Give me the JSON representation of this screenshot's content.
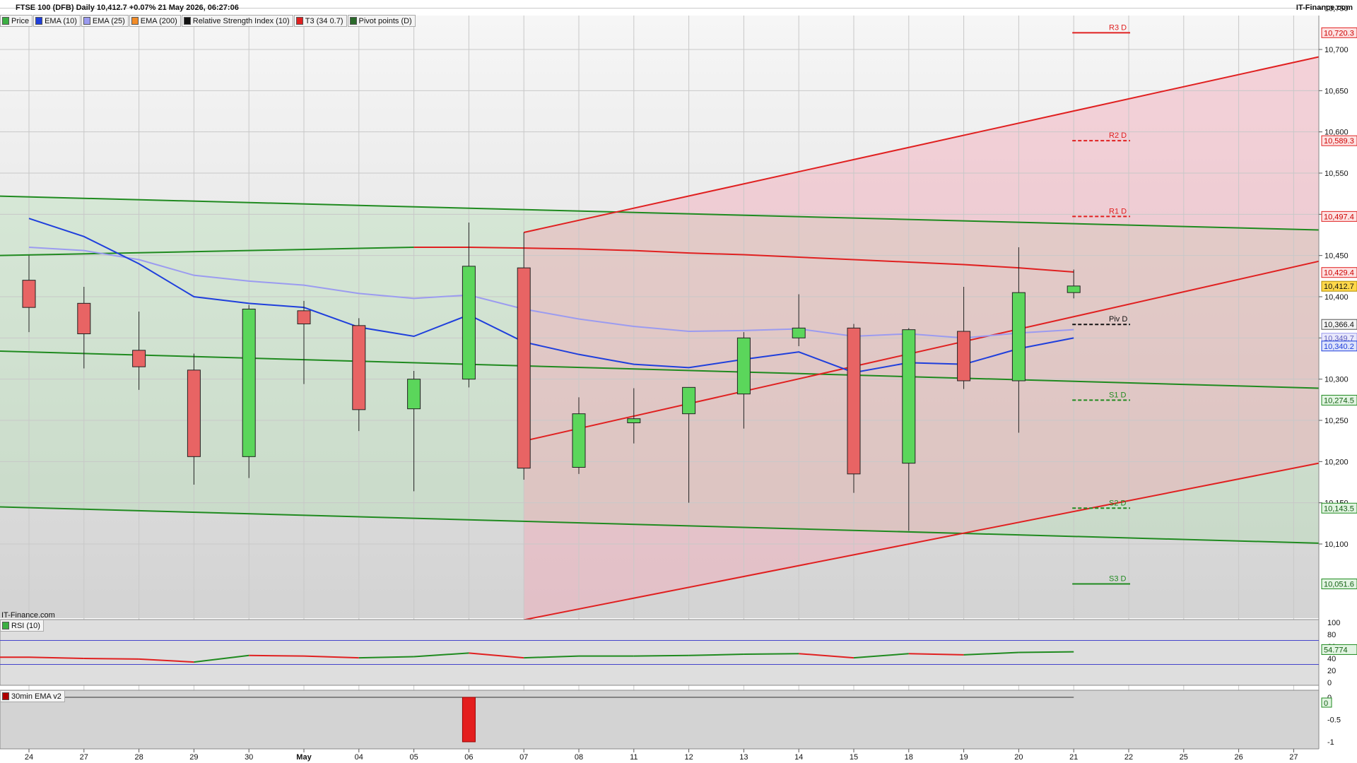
{
  "title": "FTSE 100 (DFB) Daily 10,412.7 +0.07% 21 May 2026, 06:27:06",
  "brand": "IT-Finance.com",
  "watermark": "IT-Finance.com",
  "legend": [
    {
      "label": "Price",
      "color": "#3cb043"
    },
    {
      "label": "EMA (10)",
      "color": "#1f3fdc"
    },
    {
      "label": "EMA (25)",
      "color": "#9b9bf0"
    },
    {
      "label": "EMA (200)",
      "color": "#f28c28"
    },
    {
      "label": "Relative Strength Index (10)",
      "color": "#111111"
    },
    {
      "label": "T3 (34 0.7)",
      "color": "#e02020"
    },
    {
      "label": "Pivot points (D)",
      "color": "#2a6a2a"
    }
  ],
  "rsi_panel": {
    "label": "RSI (10)",
    "ticks": [
      "100",
      "80",
      "60",
      "40",
      "20",
      "0"
    ],
    "last": "54.774"
  },
  "ema_panel": {
    "label": "30min EMA v2",
    "ticks": [
      "0",
      "-0.5",
      "-1"
    ],
    "last": "0"
  },
  "colors": {
    "bull": "#5bd65b",
    "bear": "#e86464",
    "ema10": "#1f3fdc",
    "ema25": "#9b9bf0",
    "t3": "#e02020",
    "channel_green": "#1f8a1f",
    "channel_red": "#e02020"
  },
  "chart_data": {
    "type": "candlestick",
    "x": [
      "24",
      "27",
      "28",
      "29",
      "30",
      "May",
      "04",
      "05",
      "06",
      "07",
      "08",
      "11",
      "12",
      "13",
      "14",
      "15",
      "18",
      "19",
      "20",
      "21",
      "22",
      "25",
      "26",
      "27"
    ],
    "ylim": [
      10010,
      10760
    ],
    "y_ticks": [
      "10,100",
      "10,150",
      "10,200",
      "10,250",
      "10,300",
      "10,350",
      "10,400",
      "10,450",
      "10,500",
      "10,550",
      "10,600",
      "10,650",
      "10,700",
      "10,750"
    ],
    "candles": [
      {
        "o": 10420,
        "h": 10450,
        "l": 10357,
        "c": 10387
      },
      {
        "o": 10392,
        "h": 10412,
        "l": 10313,
        "c": 10355
      },
      {
        "o": 10335,
        "h": 10382,
        "l": 10287,
        "c": 10315
      },
      {
        "o": 10311,
        "h": 10331,
        "l": 10172,
        "c": 10206
      },
      {
        "o": 10206,
        "h": 10390,
        "l": 10180,
        "c": 10385
      },
      {
        "o": 10383,
        "h": 10395,
        "l": 10294,
        "c": 10367
      },
      {
        "o": 10365,
        "h": 10374,
        "l": 10237,
        "c": 10263
      },
      {
        "o": 10264,
        "h": 10310,
        "l": 10164,
        "c": 10300
      },
      {
        "o": 10300,
        "h": 10490,
        "l": 10290,
        "c": 10437
      },
      {
        "o": 10435,
        "h": 10478,
        "l": 10178,
        "c": 10192
      },
      {
        "o": 10193,
        "h": 10278,
        "l": 10185,
        "c": 10258
      },
      {
        "o": 10247,
        "h": 10289,
        "l": 10222,
        "c": 10252
      },
      {
        "o": 10258,
        "h": 10290,
        "l": 10150,
        "c": 10290
      },
      {
        "o": 10282,
        "h": 10357,
        "l": 10240,
        "c": 10350
      },
      {
        "o": 10350,
        "h": 10403,
        "l": 10340,
        "c": 10362
      },
      {
        "o": 10362,
        "h": 10367,
        "l": 10162,
        "c": 10185
      },
      {
        "o": 10198,
        "h": 10362,
        "l": 10116,
        "c": 10360
      },
      {
        "o": 10358,
        "h": 10412,
        "l": 10288,
        "c": 10298
      },
      {
        "o": 10298,
        "h": 10460,
        "l": 10235,
        "c": 10405
      },
      {
        "o": 10405,
        "h": 10433,
        "l": 10398,
        "c": 10413
      }
    ],
    "series": [
      {
        "name": "EMA (10)",
        "values": [
          10495,
          10473,
          10440,
          10400,
          10392,
          10387,
          10363,
          10352,
          10378,
          10345,
          10330,
          10318,
          10314,
          10324,
          10333,
          10308,
          10320,
          10318,
          10337,
          10350
        ]
      },
      {
        "name": "EMA (25)",
        "values": [
          10460,
          10456,
          10445,
          10426,
          10419,
          10414,
          10404,
          10398,
          10402,
          10385,
          10373,
          10364,
          10358,
          10359,
          10361,
          10352,
          10355,
          10350,
          10356,
          10360
        ]
      },
      {
        "name": "T3 (34 0.7)",
        "values": [
          null,
          null,
          null,
          null,
          null,
          null,
          null,
          10460,
          10460,
          10459,
          10458,
          10456,
          10453,
          10451,
          10448,
          10445,
          10442,
          10439,
          10435,
          10430
        ]
      }
    ],
    "pivots": [
      {
        "label": "R3 D",
        "value": 10720.3,
        "tag": "10,720.3"
      },
      {
        "label": "R2 D",
        "value": 10589.3,
        "tag": "10,589.3"
      },
      {
        "label": "R1 D",
        "value": 10497.4,
        "tag": "10,497.4"
      },
      {
        "label": "Piv D",
        "value": 10366.4,
        "tag": "10,366.4"
      },
      {
        "label": "S1 D",
        "value": 10274.5,
        "tag": "10,274.5"
      },
      {
        "label": "S2 D",
        "value": 10143.5,
        "tag": "10,143.5"
      },
      {
        "label": "S3 D",
        "value": 10051.6,
        "tag": "10,051.6"
      }
    ],
    "price_tags": [
      {
        "tag": "10,429.4",
        "value": 10429.4
      },
      {
        "tag": "10,412.7",
        "value": 10412.7
      },
      {
        "tag": "10,349.7",
        "value": 10349.7
      },
      {
        "tag": "10,340.2",
        "value": 10340.2
      }
    ],
    "rsi": [
      42,
      40,
      39,
      34,
      45,
      44,
      41,
      43,
      49,
      41,
      44,
      44,
      45,
      47,
      48,
      41,
      48,
      46,
      50,
      51
    ],
    "ema_histogram": [
      0,
      0,
      0,
      0,
      0,
      0,
      0,
      0,
      -1,
      0,
      0,
      0,
      0,
      0,
      0,
      0,
      0,
      0,
      0,
      0
    ]
  }
}
